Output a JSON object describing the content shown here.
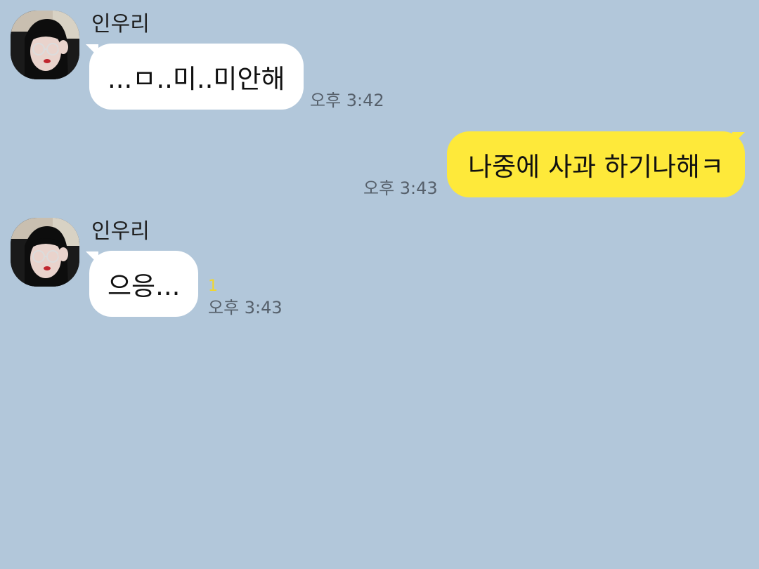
{
  "colors": {
    "background": "#b2c7da",
    "incoming_bubble": "#ffffff",
    "outgoing_bubble": "#fee93a",
    "timestamp": "#56606b",
    "unread_count": "#f2d72b"
  },
  "messages": [
    {
      "direction": "incoming",
      "sender": "인우리",
      "avatar_icon": "profile-photo",
      "text": "...ㅁ..미..미안해",
      "time": "오후 3:42"
    },
    {
      "direction": "outgoing",
      "text": "나중에 사과 하기나해ㅋ",
      "time": "오후 3:43"
    },
    {
      "direction": "incoming",
      "sender": "인우리",
      "avatar_icon": "profile-photo",
      "text": "으응...",
      "unread_count": "1",
      "time": "오후 3:43"
    }
  ]
}
